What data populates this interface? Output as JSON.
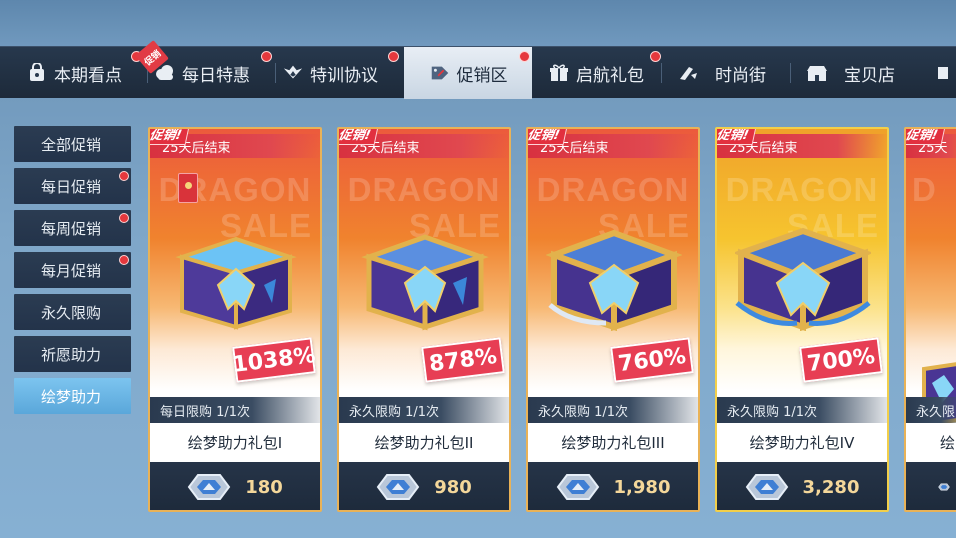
{
  "tabs": [
    {
      "label": "本期看点",
      "icon": "bag-icon",
      "badge": true
    },
    {
      "label": "每日特惠",
      "icon": "cloud-icon",
      "badge": true,
      "flag": "促销"
    },
    {
      "label": "特训协议",
      "icon": "wings-icon",
      "badge": true
    },
    {
      "label": "促销区",
      "icon": "sale-tag-icon",
      "badge": true,
      "active": true
    },
    {
      "label": "启航礼包",
      "icon": "gift-icon",
      "badge": true
    },
    {
      "label": "时尚街",
      "icon": "fashion-icon",
      "badge": false
    },
    {
      "label": "宝贝店",
      "icon": "shop-icon",
      "badge": false
    }
  ],
  "sidebar": {
    "items": [
      {
        "label": "全部促销",
        "badge": false
      },
      {
        "label": "每日促销",
        "badge": true
      },
      {
        "label": "每周促销",
        "badge": true
      },
      {
        "label": "每月促销",
        "badge": true
      },
      {
        "label": "永久限购",
        "badge": false
      },
      {
        "label": "祈愿助力",
        "badge": false
      },
      {
        "label": "绘梦助力",
        "badge": false,
        "active": true
      }
    ]
  },
  "cards": [
    {
      "promo_tag": "促销!",
      "ends": "25天后结束",
      "watermark1": "DRAGON",
      "watermark2": "SALE",
      "discount": "1038%",
      "limit": "每日限购 1/1次",
      "name": "绘梦助力礼包I",
      "price": "180",
      "theme": "orange"
    },
    {
      "promo_tag": "促销!",
      "ends": "25天后结束",
      "watermark1": "DRAGON",
      "watermark2": "SALE",
      "discount": "878%",
      "limit": "永久限购 1/1次",
      "name": "绘梦助力礼包II",
      "price": "980",
      "theme": "orange"
    },
    {
      "promo_tag": "促销!",
      "ends": "25天后结束",
      "watermark1": "DRAGON",
      "watermark2": "SALE",
      "discount": "760%",
      "limit": "永久限购 1/1次",
      "name": "绘梦助力礼包III",
      "price": "1,980",
      "theme": "orange"
    },
    {
      "promo_tag": "促销!",
      "ends": "25天后结束",
      "watermark1": "DRAGON",
      "watermark2": "SALE",
      "discount": "700%",
      "limit": "永久限购 1/1次",
      "name": "绘梦助力礼包IV",
      "price": "3,280",
      "theme": "gold"
    },
    {
      "promo_tag": "促销!",
      "ends": "25天",
      "watermark1": "D",
      "watermark2": "",
      "discount": "",
      "limit": "永久限",
      "name": "绘",
      "price": "",
      "theme": "orange"
    }
  ],
  "colors": {
    "accent_red": "#e5383d",
    "nav_dark": "#23334a",
    "nav_active": "#5aa7da",
    "card_border": "#e9b257",
    "price_text": "#f4d79a"
  }
}
